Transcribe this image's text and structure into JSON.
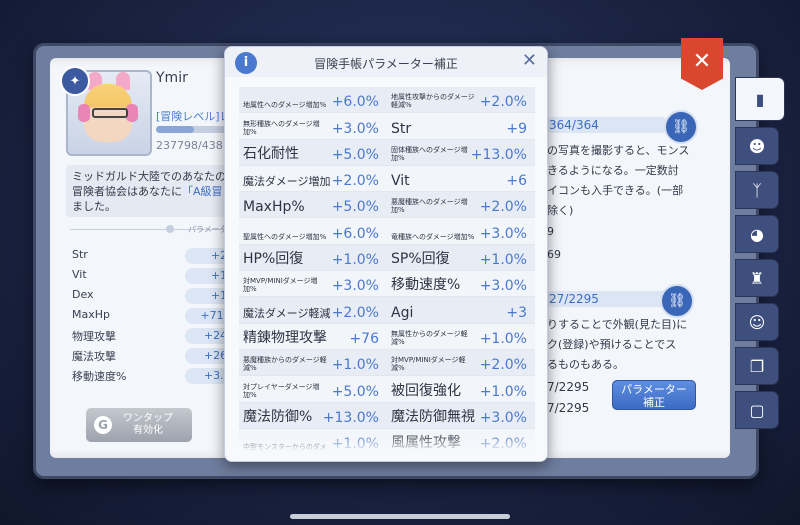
{
  "player": {
    "name": "Ymir",
    "adventure_level": "[冒険レベル]レ",
    "exp_text": "237798/438",
    "exp_progress": 0.54,
    "description": {
      "line1": "ミッドガルド大陸でのあなたの",
      "line2_pre": "冒険者協会はあなたに",
      "line2_hl": "「A級冒",
      "line3": "ました。"
    },
    "param_label": "パラメーター"
  },
  "stats": [
    {
      "label": "Str",
      "value": "+21"
    },
    {
      "label": "Vit",
      "value": "+18"
    },
    {
      "label": "Dex",
      "value": "+19"
    },
    {
      "label": "MaxHp",
      "value": "+71712"
    },
    {
      "label": "物理攻撃",
      "value": "+2429"
    },
    {
      "label": "魔法攻撃",
      "value": "+2615"
    },
    {
      "label": "移動速度%",
      "value": "+3.0%"
    }
  ],
  "onetap": {
    "line1": "ワンタップ",
    "line2": "有効化"
  },
  "right_page": {
    "count1": "364/364",
    "desc1": [
      "の写真を撮影すると、モンス",
      "きるようになる。一定数討",
      "イコンも入手できる。(一部",
      "除く)"
    ],
    "num_a": "9",
    "num_b": "69",
    "count2": "27/2295",
    "desc2": [
      "りすることで外観(見た目)に",
      "ク(登録)や預けることでス",
      "るものもある。"
    ],
    "count3": "7/2295",
    "count4": "7/2295",
    "param_button": {
      "line1": "パラメーター",
      "line2": "補正"
    }
  },
  "close_label": "✕",
  "popup": {
    "title": "冒険手帳パラメーター補正",
    "info": "i",
    "close": "✕",
    "items": [
      {
        "label": "地属性へのダメージ増加%",
        "value": "+6.0%",
        "size": "small"
      },
      {
        "label": "地属性攻撃からのダメージ軽減%",
        "value": "+2.0%",
        "size": "small"
      },
      {
        "label": "無形種族へのダメージ増加%",
        "value": "+3.0%",
        "size": "small"
      },
      {
        "label": "Str",
        "value": "+9",
        "size": "big"
      },
      {
        "label": "石化耐性",
        "value": "+5.0%",
        "size": "big"
      },
      {
        "label": "固体種族へのダメージ増加%",
        "value": "+13.0%",
        "size": "small"
      },
      {
        "label": "魔法ダメージ増加",
        "value": "+2.0%",
        "size": "mid"
      },
      {
        "label": "Vit",
        "value": "+6",
        "size": "big"
      },
      {
        "label": "MaxHp%",
        "value": "+5.0%",
        "size": "big"
      },
      {
        "label": "悪魔種族へのダメージ増加%",
        "value": "+2.0%",
        "size": "small"
      },
      {
        "label": "聖属性へのダメージ増加%",
        "value": "+6.0%",
        "size": "small"
      },
      {
        "label": "竜種族へのダメージ増加%",
        "value": "+3.0%",
        "size": "small"
      },
      {
        "label": "HP%回復",
        "value": "+1.0%",
        "size": "big"
      },
      {
        "label": "SP%回復",
        "value": "+1.0%",
        "size": "big"
      },
      {
        "label": "対MVP/MINIダメージ増加%",
        "value": "+3.0%",
        "size": "small"
      },
      {
        "label": "移動速度%",
        "value": "+3.0%",
        "size": "big"
      },
      {
        "label": "魔法ダメージ軽減",
        "value": "+2.0%",
        "size": "mid"
      },
      {
        "label": "Agi",
        "value": "+3",
        "size": "big"
      },
      {
        "label": "精錬物理攻撃",
        "value": "+76",
        "size": "big"
      },
      {
        "label": "無属性からのダメージ軽減%",
        "value": "+1.0%",
        "size": "small"
      },
      {
        "label": "悪魔種族からのダメージ軽減%",
        "value": "+1.0%",
        "size": "small"
      },
      {
        "label": "対MVP/MINIダメージ軽減%",
        "value": "+2.0%",
        "size": "small"
      },
      {
        "label": "対プレイヤーダメージ増加%",
        "value": "+5.0%",
        "size": "small"
      },
      {
        "label": "被回復強化",
        "value": "+1.0%",
        "size": "big"
      },
      {
        "label": "魔法防御%",
        "value": "+13.0%",
        "size": "big"
      },
      {
        "label": "魔法防御無視",
        "value": "+3.0%",
        "size": "big"
      },
      {
        "label": "中型モンスターからのダメ",
        "value": "+1.0%",
        "size": "small"
      },
      {
        "label": "風属性攻撃",
        "value": "+2.0%",
        "size": "big"
      }
    ]
  },
  "colors": {
    "accent": "#4a79cf",
    "close_red": "#d8472e",
    "tab_navy": "#3e4f7d"
  },
  "icons": [
    "info-icon",
    "close-icon",
    "link-icon",
    "book-icon",
    "mask-icon",
    "horn-icon",
    "chick-icon",
    "chef-hat-icon",
    "head-icon",
    "open-book-icon"
  ]
}
